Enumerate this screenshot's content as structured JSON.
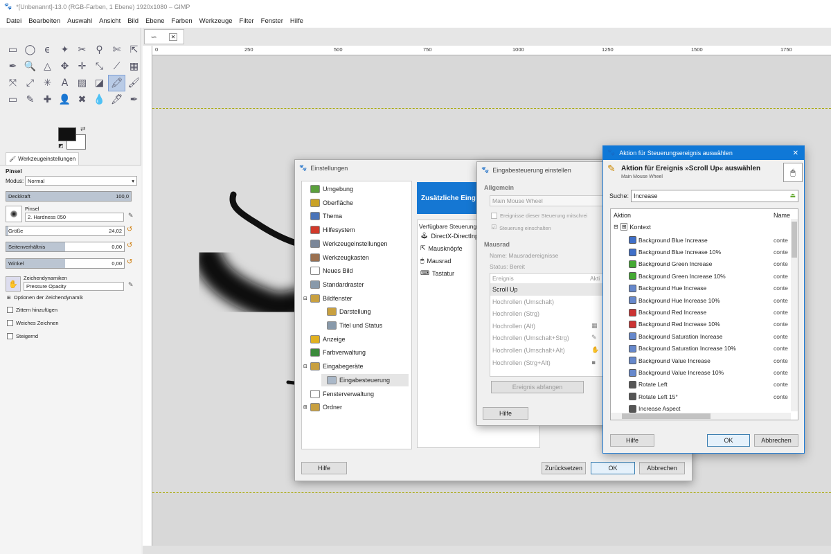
{
  "window": {
    "title": "*[Unbenannt]-13.0 (RGB-Farben, 1 Ebene) 1920x1080 – GIMP"
  },
  "menu": [
    "Datei",
    "Bearbeiten",
    "Auswahl",
    "Ansicht",
    "Bild",
    "Ebene",
    "Farben",
    "Werkzeuge",
    "Filter",
    "Fenster",
    "Hilfe"
  ],
  "ruler": [
    "0",
    "250",
    "500",
    "750",
    "1000",
    "1250",
    "1500",
    "1750"
  ],
  "tool_options": {
    "tab": "Werkzeugeinstellungen",
    "tool": "Pinsel",
    "mode_label": "Modus:",
    "mode_value": "Normal",
    "opacity_label": "Deckkraft",
    "opacity_value": "100,0",
    "opacity_fraction": 1.0,
    "brush_label": "Pinsel",
    "brush_value": "2. Hardness 050",
    "size_label": "Größe",
    "size_value": "24,02",
    "size_fraction": 0.02,
    "aspect_label": "Seitenverhältnis",
    "aspect_value": "0,00",
    "aspect_fraction": 0.5,
    "angle_label": "Winkel",
    "angle_value": "0,00",
    "angle_fraction": 0.5,
    "dyn_label": "Zeichendynamiken",
    "dyn_value": "Pressure Opacity",
    "dyn_options": "Optionen der Zeichendynamik",
    "jitter": "Zittern hinzufügen",
    "smooth": "Weiches Zeichnen",
    "increment": "Steigernd"
  },
  "einstellungen": {
    "title": "Einstellungen",
    "items": [
      {
        "label": "Umgebung",
        "color": "#5aa03c",
        "indent": 0
      },
      {
        "label": "Oberfläche",
        "color": "#c9a227",
        "indent": 0
      },
      {
        "label": "Thema",
        "color": "#4a74b9",
        "indent": 0
      },
      {
        "label": "Hilfesystem",
        "color": "#d23a2a",
        "indent": 0
      },
      {
        "label": "Werkzeugeinstellungen",
        "color": "#7b8799",
        "indent": 0
      },
      {
        "label": "Werkzeugkasten",
        "color": "#9a7050",
        "indent": 0
      },
      {
        "label": "Neues Bild",
        "color": "#ffffff",
        "indent": 0
      },
      {
        "label": "Standardraster",
        "color": "#8899aa",
        "indent": 0
      },
      {
        "label": "Bildfenster",
        "color": "#c8a040",
        "indent": 0
      },
      {
        "label": "Darstellung",
        "color": "#c8a040",
        "indent": 1
      },
      {
        "label": "Titel und Status",
        "color": "#8899aa",
        "indent": 1
      },
      {
        "label": "Anzeige",
        "color": "#e0b020",
        "indent": 0
      },
      {
        "label": "Farbverwaltung",
        "color": "#3c8a3c",
        "indent": 0
      },
      {
        "label": "Eingabegeräte",
        "color": "#c8a040",
        "indent": 0
      },
      {
        "label": "Eingabesteuerung",
        "color": "#aab8c8",
        "indent": 1
      },
      {
        "label": "Fensterverwaltung",
        "color": "#ffffff",
        "indent": 0
      },
      {
        "label": "Ordner",
        "color": "#c8a040",
        "indent": 0
      }
    ],
    "header": "Zusätzliche Eing",
    "devices_label": "Verfügbare Steuerung",
    "devices": [
      "DirectX-DirectInp",
      "Mausknöpfe",
      "Mausrad",
      "Tastatur"
    ],
    "help": "Hilfe",
    "reset": "Zurücksetzen",
    "ok": "OK",
    "cancel": "Abbrechen"
  },
  "eingabe": {
    "title": "Eingabesteuerung einstellen",
    "general": "Allgemein",
    "device_name": "Main Mouse Wheel",
    "dump_events": "Ereignisse dieser Steuerung mitschrei",
    "enable": "Steuerung einschalten",
    "section": "Mausrad",
    "name_line": "Name:  Mausradereignisse",
    "status_line": "Status:  Bereit",
    "col_event": "Ereignis",
    "col_action": "Akti",
    "events": [
      "Scroll Up",
      "Hochrollen (Umschalt)",
      "Hochrollen (Strg)",
      "Hochrollen (Alt)",
      "Hochrollen (Umschalt+Strg)",
      "Hochrollen (Umschalt+Alt)",
      "Hochrollen (Strg+Alt)"
    ],
    "grab": "Ereignis abfangen",
    "help": "Hilfe"
  },
  "aktion": {
    "window_title": "Aktion für Steuerungsereignis auswählen",
    "heading": "Aktion für Ereignis »Scroll Up« auswählen",
    "subheading": "Main Mouse Wheel",
    "search_label": "Suche:",
    "search_value": "Increase",
    "col_action": "Aktion",
    "col_name": "Name",
    "group": "Kontext",
    "rows": [
      {
        "label": "Background Blue Increase",
        "name": "conte",
        "color": "#3f6fc8"
      },
      {
        "label": "Background Blue Increase 10%",
        "name": "conte",
        "color": "#3f6fc8"
      },
      {
        "label": "Background Green Increase",
        "name": "conte",
        "color": "#44aa33"
      },
      {
        "label": "Background Green Increase 10%",
        "name": "conte",
        "color": "#44aa33"
      },
      {
        "label": "Background Hue Increase",
        "name": "conte",
        "color": "#6688cc"
      },
      {
        "label": "Background Hue Increase 10%",
        "name": "conte",
        "color": "#6688cc"
      },
      {
        "label": "Background Red Increase",
        "name": "conte",
        "color": "#cc3333"
      },
      {
        "label": "Background Red Increase 10%",
        "name": "conte",
        "color": "#cc3333"
      },
      {
        "label": "Background Saturation Increase",
        "name": "conte",
        "color": "#6688cc"
      },
      {
        "label": "Background Saturation Increase 10%",
        "name": "conte",
        "color": "#6688cc"
      },
      {
        "label": "Background Value Increase",
        "name": "conte",
        "color": "#6688cc"
      },
      {
        "label": "Background Value Increase 10%",
        "name": "conte",
        "color": "#6688cc"
      },
      {
        "label": "Rotate Left",
        "name": "conte",
        "color": "#555555"
      },
      {
        "label": "Rotate Left 15°",
        "name": "conte",
        "color": "#555555"
      },
      {
        "label": "Increase Aspect",
        "name": "",
        "color": "#555555"
      }
    ],
    "help": "Hilfe",
    "ok": "OK",
    "cancel": "Abbrechen"
  }
}
